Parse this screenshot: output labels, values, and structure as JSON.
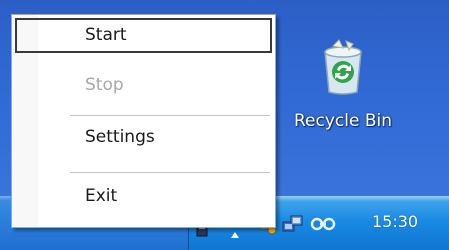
{
  "desktop": {
    "recycle_bin_label": "Recycle Bin"
  },
  "context_menu": {
    "items": [
      {
        "label": "Start",
        "state": "highlighted"
      },
      {
        "label": "Stop",
        "state": "disabled"
      },
      {
        "label": "Settings",
        "state": "normal"
      },
      {
        "label": "Exit",
        "state": "normal"
      }
    ]
  },
  "taskbar": {
    "clock": "15:30"
  },
  "colors": {
    "desktop": "#3169d4",
    "taskbar": "#2f84df",
    "tray": "#1a8ae4"
  }
}
